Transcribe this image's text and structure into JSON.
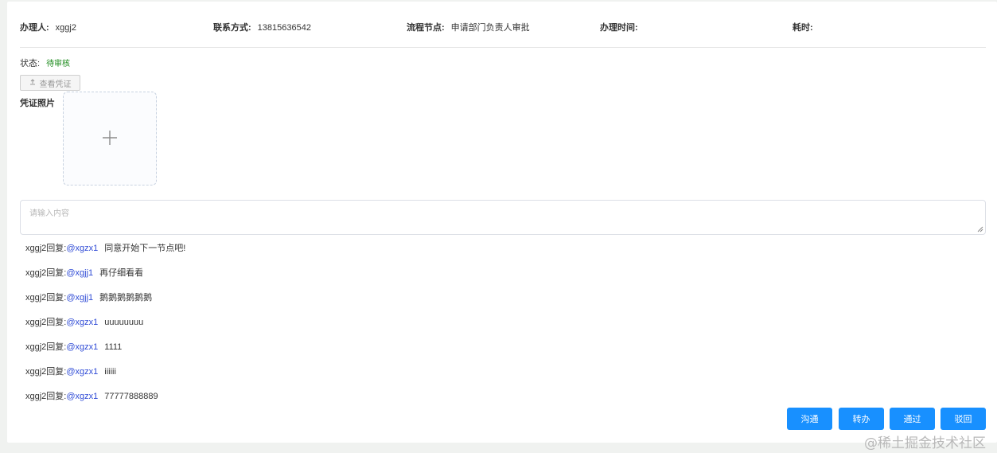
{
  "info": {
    "handler_label": "办理人:",
    "handler_value": "xggj2",
    "contact_label": "联系方式:",
    "contact_value": "13815636542",
    "node_label": "流程节点:",
    "node_value": "申请部门负责人审批",
    "time_label": "办理时间:",
    "time_value": "",
    "duration_label": "耗时:",
    "duration_value": ""
  },
  "status": {
    "label": "状态:",
    "value": "待审核"
  },
  "view_button": {
    "icon": "upload-icon",
    "label": "查看凭证"
  },
  "photo": {
    "label": "凭证照片",
    "upload_icon": "plus-icon"
  },
  "comment": {
    "placeholder": "请输入内容",
    "value": ""
  },
  "replies": [
    {
      "user": "xggj2回复:",
      "mention": "@xgzx1",
      "message": "同意开始下一节点吧!"
    },
    {
      "user": "xggj2回复:",
      "mention": "@xgjj1",
      "message": "再仔细看看"
    },
    {
      "user": "xggj2回复:",
      "mention": "@xgjj1",
      "message": "鹅鹅鹅鹅鹅鹅"
    },
    {
      "user": "xggj2回复:",
      "mention": "@xgzx1",
      "message": "uuuuuuuu"
    },
    {
      "user": "xggj2回复:",
      "mention": "@xgzx1",
      "message": "1111"
    },
    {
      "user": "xggj2回复:",
      "mention": "@xgzx1",
      "message": "iiiiii"
    },
    {
      "user": "xggj2回复:",
      "mention": "@xgzx1",
      "message": "77777888889"
    }
  ],
  "actions": {
    "communicate": "沟通",
    "transfer": "转办",
    "approve": "通过",
    "reject": "驳回"
  },
  "colors": {
    "primary": "#1890ff",
    "status_pending": "#1a8a1a",
    "mention": "#2f4bd6"
  },
  "watermark": "@稀土掘金技术社区"
}
